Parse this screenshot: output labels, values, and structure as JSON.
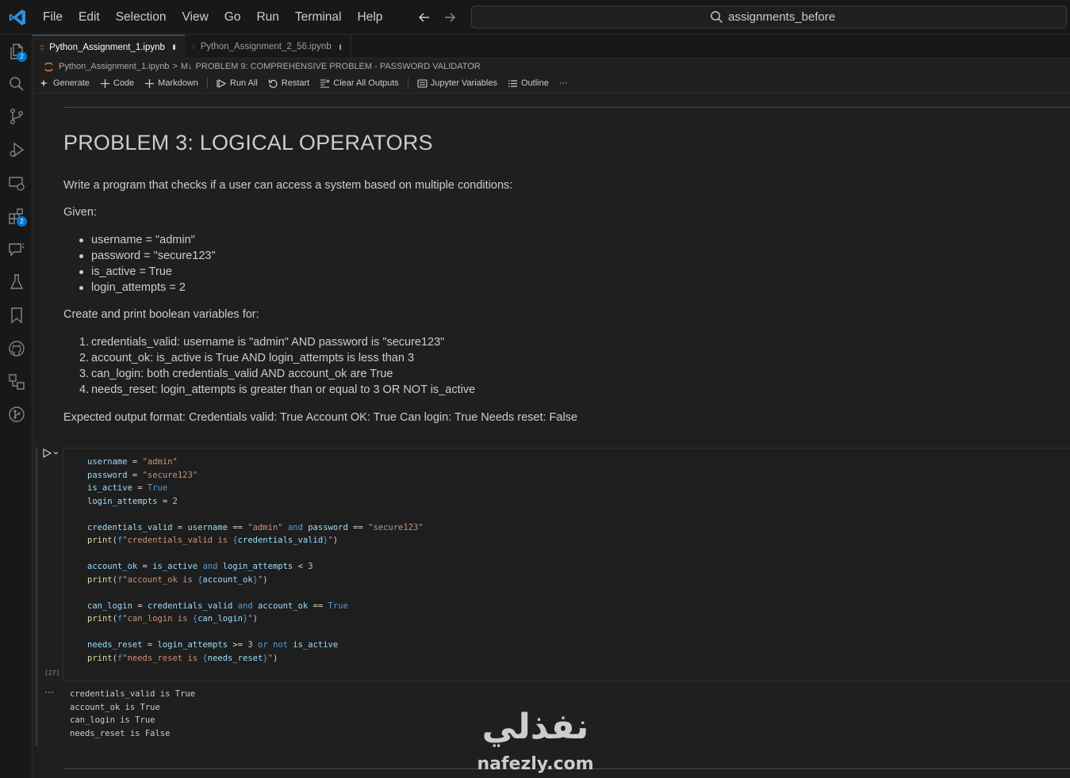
{
  "menu": [
    "File",
    "Edit",
    "Selection",
    "View",
    "Go",
    "Run",
    "Terminal",
    "Help"
  ],
  "search": {
    "text": "assignments_before"
  },
  "activity": {
    "explorer_badge": "2",
    "extensions_badge": "2"
  },
  "tabs": [
    {
      "label": "Python_Assignment_1.ipynb",
      "active": true
    },
    {
      "label": "Python_Assignment_2_56.ipynb",
      "active": false
    }
  ],
  "breadcrumb": {
    "file": "Python_Assignment_1.ipynb",
    "sep": ">",
    "md_prefix": "M↓",
    "section": "PROBLEM 9: COMPREHENSIVE PROBLEM - PASSWORD VALIDATOR"
  },
  "toolbar": {
    "generate": "Generate",
    "code": "Code",
    "markdown": "Markdown",
    "run_all": "Run All",
    "restart": "Restart",
    "clear_outputs": "Clear All Outputs",
    "jupyter_vars": "Jupyter Variables",
    "outline": "Outline",
    "more": "···"
  },
  "markdown": {
    "title": "PROBLEM 3: LOGICAL OPERATORS",
    "intro": "Write a program that checks if a user can access a system based on multiple conditions:",
    "given": "Given:",
    "bullets": [
      "username = \"admin\"",
      "password = \"secure123\"",
      "is_active = True",
      "login_attempts = 2"
    ],
    "create": "Create and print boolean variables for:",
    "numbered": [
      "credentials_valid: username is \"admin\" AND password is \"secure123\"",
      "account_ok: is_active is True AND login_attempts is less than 3",
      "can_login: both credentials_valid AND account_ok are True",
      "needs_reset: login_attempts is greater than or equal to 3 OR NOT is_active"
    ],
    "numbers": [
      "1.",
      "2.",
      "3.",
      "4."
    ],
    "expected": "Expected output format: Credentials valid: True Account OK: True Can login: True Needs reset: False"
  },
  "cell": {
    "exec_count": "[27]"
  },
  "output": {
    "ellipsis": "···",
    "lines": [
      "credentials_valid is True",
      "account_ok is True",
      "can_login is True",
      "needs_reset is False"
    ]
  },
  "watermark": {
    "arabic": "نفذلي",
    "latin": "nafezly.com"
  }
}
